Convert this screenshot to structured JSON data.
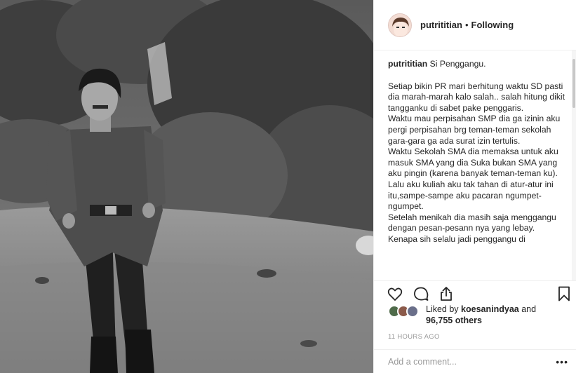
{
  "post": {
    "username": "putrititian",
    "separator": "•",
    "follow_status": "Following"
  },
  "caption": {
    "username": "putrititian",
    "title": "Si Penggangu.",
    "body": "Setiap bikin PR mari berhitung waktu SD pasti dia marah-marah kalo salah.. salah hitung dikit tangganku di sabet pake penggaris.\nWaktu mau perpisahan SMP dia ga izinin aku pergi perpisahan brg teman-teman sekolah gara-gara ga ada surat izin tertulis.\nWaktu Sekolah SMA dia memaksa untuk aku masuk SMA yang dia Suka bukan SMA yang aku pingin (karena banyak teman-teman ku).\nLalu aku kuliah aku tak tahan di atur-atur ini itu,sampe-sampe aku pacaran ngumpet-ngumpet.\nSetelah menikah dia masih saja menggangu dengan pesan-pesann nya yang lebay.\nKenapa sih selalu jadi penggangu di"
  },
  "icons": {
    "like": "heart-outline-icon",
    "comment": "speech-bubble-icon",
    "share": "share-upload-icon",
    "save": "bookmark-icon",
    "more": "ellipsis-icon"
  },
  "likes": {
    "prefix": "Liked by",
    "user": "koesanindyaa",
    "connector": "and",
    "count": "96,755 others"
  },
  "timestamp": "11 HOURS AGO",
  "comment": {
    "placeholder": "Add a comment...",
    "more_label": "•••"
  }
}
